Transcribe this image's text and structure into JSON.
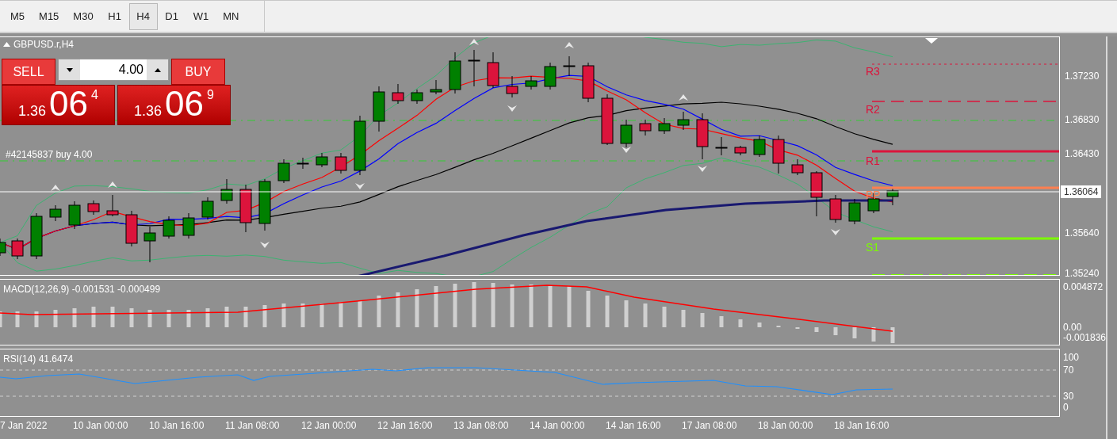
{
  "toolbar": {
    "timeframes": [
      {
        "label": "M5",
        "selected": false
      },
      {
        "label": "M15",
        "selected": false
      },
      {
        "label": "M30",
        "selected": false
      },
      {
        "label": "H1",
        "selected": false
      },
      {
        "label": "H4",
        "selected": true
      },
      {
        "label": "D1",
        "selected": false
      },
      {
        "label": "W1",
        "selected": false
      },
      {
        "label": "MN",
        "selected": false
      }
    ]
  },
  "chart": {
    "symbol": "GBPUSD.r,H4",
    "trade_panel": {
      "sell_label": "SELL",
      "buy_label": "BUY",
      "volume": "4.00",
      "sell_price": {
        "prefix": "1.36",
        "main": "06",
        "fraction": "4"
      },
      "buy_price": {
        "prefix": "1.36",
        "main": "06",
        "fraction": "9"
      }
    },
    "order_label": "#42145837 buy 4.00",
    "pivots": [
      {
        "label": "R3",
        "color": "#dc143c",
        "kind": "dotted"
      },
      {
        "label": "R2",
        "color": "#dc143c",
        "kind": "dashed"
      },
      {
        "label": "R1",
        "color": "#dc143c",
        "kind": "solid"
      },
      {
        "label": "PP",
        "color": "#ff7f50",
        "kind": "solid"
      },
      {
        "label": "S1",
        "color": "#7cfc00",
        "kind": "solid"
      }
    ],
    "price_axis": [
      "1.37230",
      "1.36830",
      "1.36430",
      "1.35640",
      "1.35240"
    ],
    "current_price": "1.36064"
  },
  "macd": {
    "label": "MACD(12,26,9) -0.001531 -0.000499",
    "axis": [
      "0.004872",
      "0.00",
      "-0.001836"
    ]
  },
  "rsi": {
    "label": "RSI(14) 41.6474",
    "axis": [
      "100",
      "70",
      "30",
      "0"
    ]
  },
  "time_axis": [
    "7 Jan 2022",
    "10 Jan 00:00",
    "10 Jan 16:00",
    "11 Jan 08:00",
    "12 Jan 00:00",
    "12 Jan 16:00",
    "13 Jan 08:00",
    "14 Jan 00:00",
    "14 Jan 16:00",
    "17 Jan 08:00",
    "18 Jan 00:00",
    "18 Jan 16:00"
  ]
}
